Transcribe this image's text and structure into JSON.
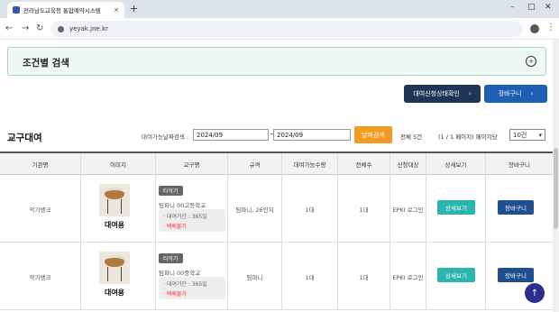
{
  "browser": {
    "tab_title": "전라남도교육청 통합예약시스템",
    "tab_close": "×",
    "new_tab": "+",
    "url": "yeyak.jne.kr",
    "min": "–",
    "max": "□",
    "close": "✕"
  },
  "filter": {
    "title": "조건별 검색",
    "toggle": "+"
  },
  "top_buttons": {
    "status": "대여신청상태확인",
    "cart": "장바구니",
    "arrow": "›"
  },
  "section": {
    "title": "교구대여",
    "search_label": "대여가능날짜검색 :",
    "date_from": "2024/09",
    "date_to": "2024/09",
    "dash": "~",
    "search_button": "날짜검색",
    "total": "전체 5건",
    "page_info": "(1 / 1 페이지) 페이지당",
    "per_page": "10건"
  },
  "table": {
    "headers": [
      "기관명",
      "이미지",
      "교구명",
      "규격",
      "대여가능수량",
      "전체수",
      "신청대상",
      "상세보기",
      "장바구니"
    ],
    "rows": [
      {
        "org": "악기뱅크",
        "image_caption": "대여용",
        "category": "타악기",
        "name": "팀파니 00고등학교",
        "period": "· 대여기간 : 365일",
        "delivery": "· 택배불가",
        "spec": "팀파니, 26인치",
        "avail": "1대",
        "total": "1대",
        "target": "EPKI 로그인",
        "detail": "상세보기",
        "cart": "장바구니"
      },
      {
        "org": "악기뱅크",
        "image_caption": "대여용",
        "category": "타악기",
        "name": "팀파니 00중학교",
        "period": "· 대여기간 : 365일",
        "delivery": "· 택배불가",
        "spec": "팀파니",
        "avail": "1대",
        "total": "1대",
        "target": "EPKI 로그인",
        "detail": "상세보기",
        "cart": "장바구니"
      }
    ]
  },
  "fab": "↑"
}
